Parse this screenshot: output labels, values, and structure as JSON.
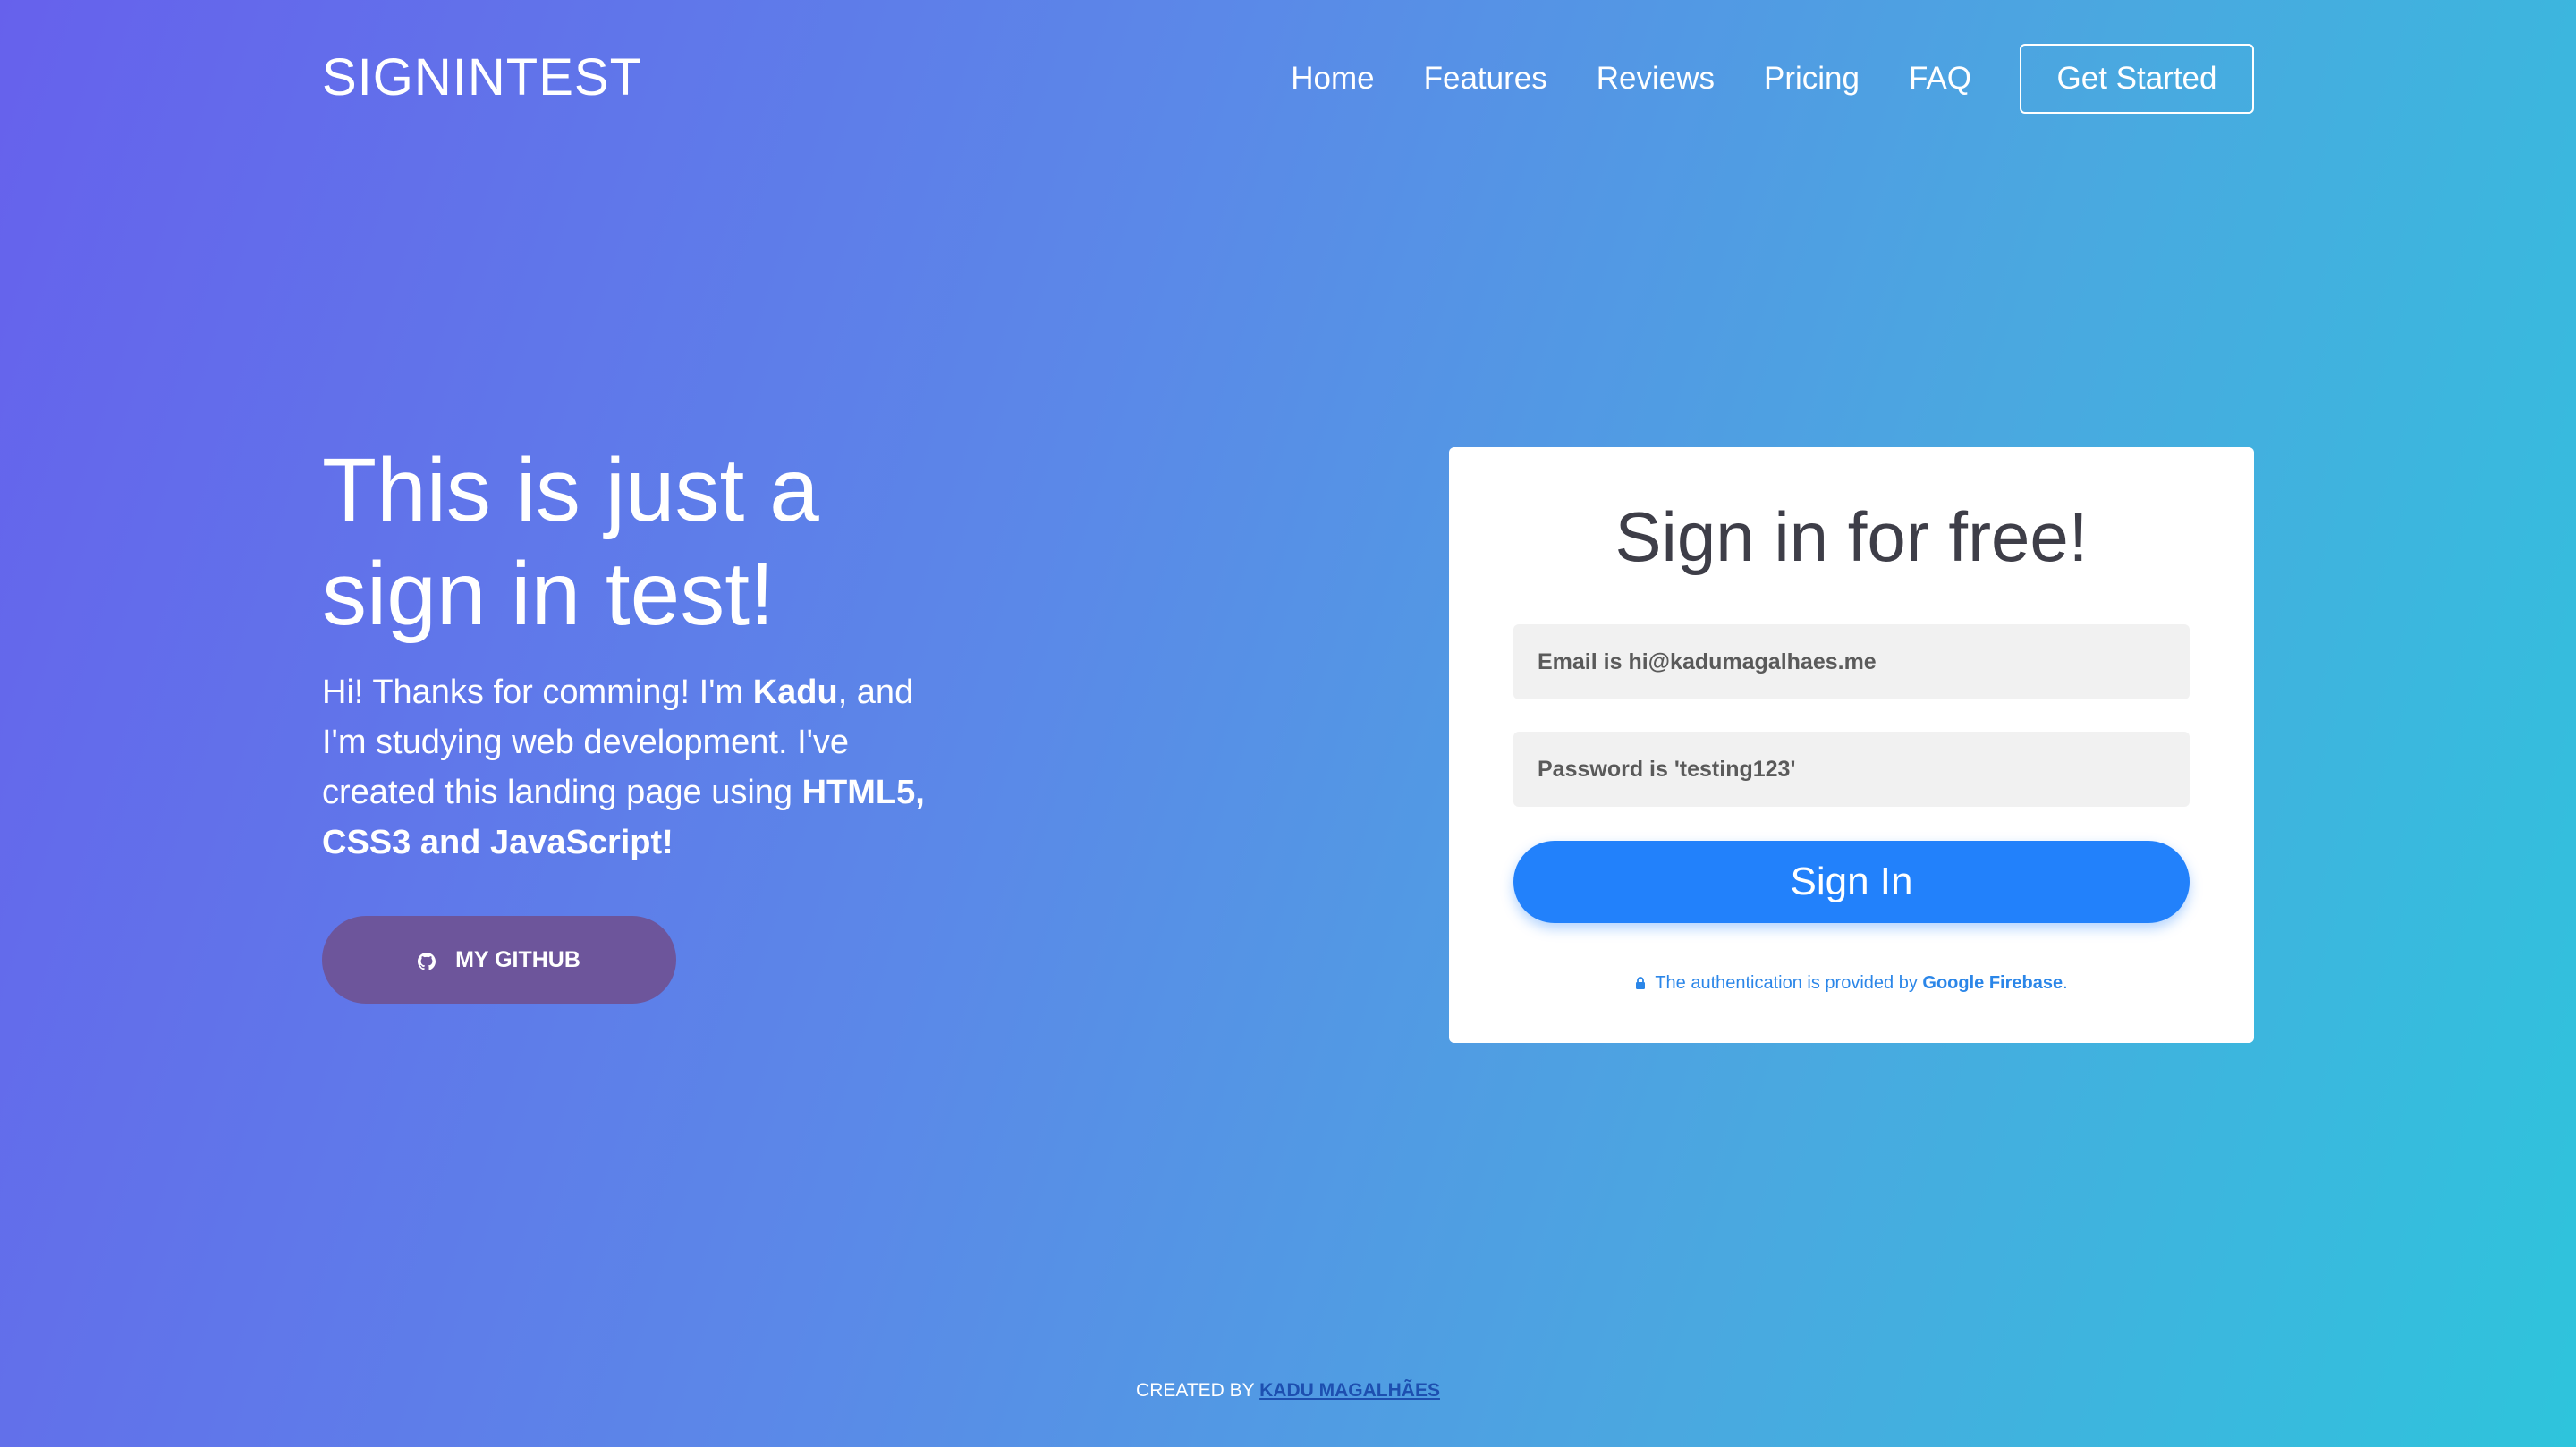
{
  "header": {
    "logo": "SIGNINTEST",
    "nav": [
      {
        "label": "Home"
      },
      {
        "label": "Features"
      },
      {
        "label": "Reviews"
      },
      {
        "label": "Pricing"
      },
      {
        "label": "FAQ"
      }
    ],
    "cta_label": "Get Started"
  },
  "hero": {
    "title": "This is just a sign in test!",
    "text_parts": {
      "p1": "Hi! Thanks for comming! I'm ",
      "name": "Kadu",
      "p2": ", and I'm studying web development. I've created this landing page using ",
      "tech": "HTML5, CSS3 and JavaScript!"
    },
    "github_label": "MY GITHUB",
    "github_icon": "github-icon"
  },
  "signin": {
    "title": "Sign in for free!",
    "email_placeholder": "Email is hi@kadumagalhaes.me",
    "password_placeholder": "Password is 'testing123'",
    "button_label": "Sign In",
    "note_prefix": "The authentication is provided by ",
    "note_link": "Google Firebase",
    "note_suffix": ".",
    "note_icon": "lock-icon"
  },
  "footer": {
    "prefix": "CREATED BY ",
    "author": "KADU MAGALHÃES"
  },
  "colors": {
    "gradient_start": "#6661ec",
    "gradient_end": "#2ec4dc",
    "signin_button": "#2281fb",
    "github_button": "#6d559b",
    "link_blue": "#2b86e8"
  }
}
